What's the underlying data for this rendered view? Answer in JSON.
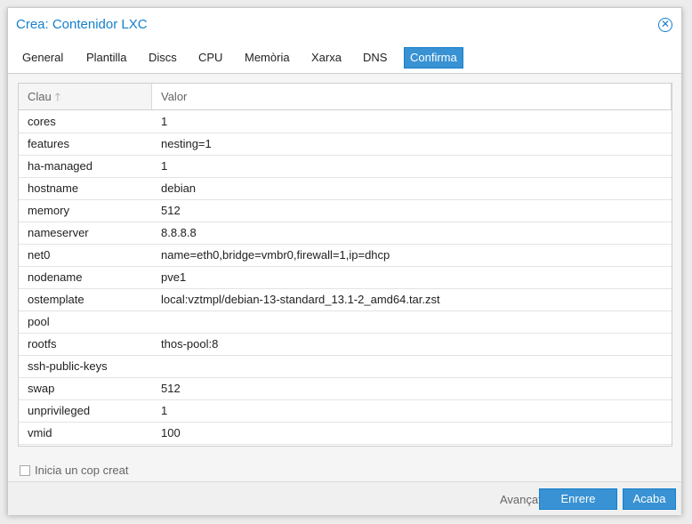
{
  "window": {
    "title": "Crea: Contenidor LXC"
  },
  "tabs": [
    {
      "label": "General"
    },
    {
      "label": "Plantilla"
    },
    {
      "label": "Discs"
    },
    {
      "label": "CPU"
    },
    {
      "label": "Memòria"
    },
    {
      "label": "Xarxa"
    },
    {
      "label": "DNS"
    },
    {
      "label": "Confirma",
      "active": true
    }
  ],
  "grid": {
    "columns": {
      "key": "Clau",
      "value": "Valor"
    },
    "sort_icon": "arrow-up-icon",
    "rows": [
      {
        "key": "cores",
        "value": "1"
      },
      {
        "key": "features",
        "value": "nesting=1"
      },
      {
        "key": "ha-managed",
        "value": "1"
      },
      {
        "key": "hostname",
        "value": "debian"
      },
      {
        "key": "memory",
        "value": "512"
      },
      {
        "key": "nameserver",
        "value": "8.8.8.8"
      },
      {
        "key": "net0",
        "value": "name=eth0,bridge=vmbr0,firewall=1,ip=dhcp"
      },
      {
        "key": "nodename",
        "value": "pve1"
      },
      {
        "key": "ostemplate",
        "value": "local:vztmpl/debian-13-standard_13.1-2_amd64.tar.zst"
      },
      {
        "key": "pool",
        "value": ""
      },
      {
        "key": "rootfs",
        "value": "thos-pool:8"
      },
      {
        "key": "ssh-public-keys",
        "value": ""
      },
      {
        "key": "swap",
        "value": "512"
      },
      {
        "key": "unprivileged",
        "value": "1"
      },
      {
        "key": "vmid",
        "value": "100"
      }
    ]
  },
  "start_after_created": {
    "label": "Inicia un cop creat",
    "checked": false
  },
  "footer": {
    "advanced_label": "Avançat",
    "advanced_checked": false,
    "back_label": "Enrere",
    "finish_label": "Acaba"
  },
  "colors": {
    "accent": "#157fcc",
    "button_bg": "#3892d3"
  }
}
